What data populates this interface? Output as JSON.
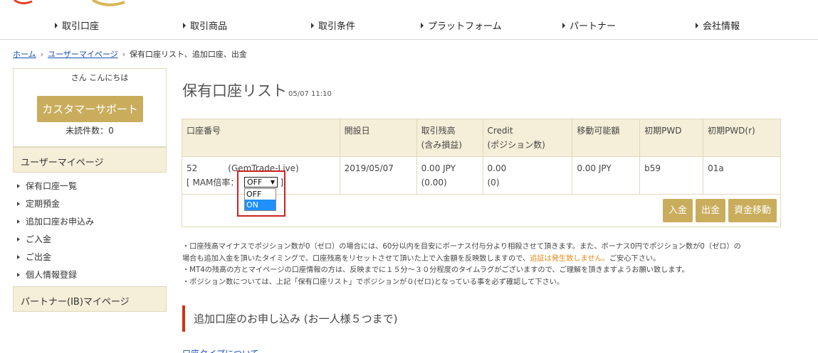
{
  "nav": {
    "items": [
      "取引口座",
      "取引商品",
      "取引条件",
      "プラットフォーム",
      "パートナー",
      "会社情報"
    ]
  },
  "breadcrumb": {
    "home": "ホーム",
    "mypage": "ユーザーマイページ",
    "current": "保有口座リスト、追加口座、出金"
  },
  "sidebar": {
    "greeting": "さん こんにちは",
    "support_button": "カスタマーサポート",
    "unread": "未読件数：0",
    "user_section": "ユーザーマイページ",
    "items": [
      "保有口座一覧",
      "定期預金",
      "追加口座お申込み",
      "ご入金",
      "ご出金",
      "個人情報登録"
    ],
    "partner_section": "パートナー(IB)マイページ"
  },
  "main": {
    "title": "保有口座リスト",
    "timestamp": "05/07 11:10",
    "table": {
      "headers": [
        [
          "口座番号"
        ],
        [
          "開設日"
        ],
        [
          "取引残高",
          "(含み損益)"
        ],
        [
          "Credit",
          "(ポジション数)"
        ],
        [
          "移動可能額"
        ],
        [
          "初期PWD"
        ],
        [
          "初期PWD(r)"
        ]
      ],
      "row": {
        "account_no": "52",
        "account_type": "(GemTrade-Live)",
        "mam_label": "[ MAM倍率：",
        "mam_close": "]",
        "open_date": "2019/05/07",
        "balance": "0.00 JPY",
        "pnl": "(0.00)",
        "credit": "0.00",
        "positions": "(0)",
        "movable": "0.00 JPY",
        "pwd": "b59",
        "pwd_r": "01a"
      },
      "buttons": {
        "deposit": "入金",
        "withdraw": "出金",
        "transfer": "資金移動"
      }
    },
    "mam_dropdown": {
      "selected": "OFF",
      "options": [
        "OFF",
        "ON"
      ],
      "highlighted": "ON"
    },
    "notes": {
      "line1a": "・口座残高マイナスでポジション数が0（ゼロ）の場合には、60分以内を目安にボーナス付与分より相殺させて頂きます。また、ボーナス0円でポジション数が0（ゼロ）の",
      "line2a": "場合も追加入金を頂いたタイミングで、口座残高をリセットさせて頂いた上で入金額を反映致しますので、",
      "line2b": "追証は発生致しません。",
      "line2c": "ご安心下さい。",
      "line3": "・MT4の残高の方とマイページの口座情報の方は、反映までに１５分～３０分程度のタイムラグがございますので、ご理解を頂きますようお願い致します。",
      "line4": "・ポジション数については、上記「保有口座リスト」でポジションが０(ゼロ)となっている事を必ず確認して下さい。"
    },
    "section_heading": "追加口座のお申し込み (お一人様５つまで)",
    "bottom_link": "口座タイプについて"
  },
  "colors": {
    "gold": "#c9ad5c",
    "header_bg": "#f5eed8",
    "highlight_red": "#cc2222",
    "link_blue": "#1a4db3",
    "notice_orange": "#e08a1a"
  }
}
